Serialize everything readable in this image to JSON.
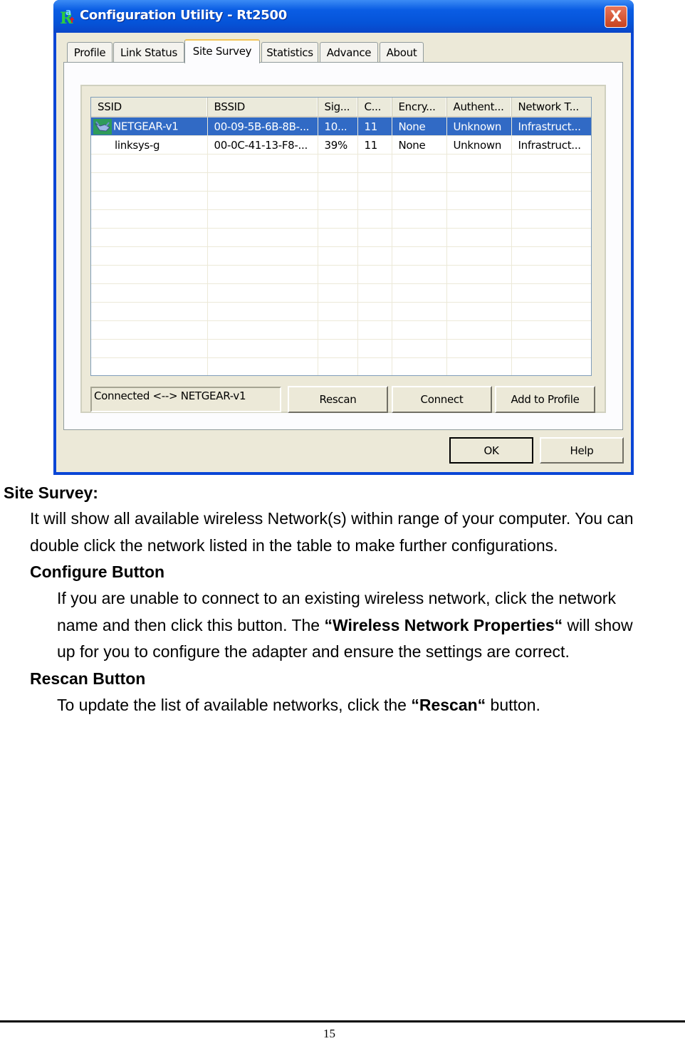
{
  "window": {
    "title": "Configuration Utility - Rt2500",
    "close_label": "X",
    "tabs": [
      {
        "label": "Profile"
      },
      {
        "label": "Link Status"
      },
      {
        "label": "Site Survey",
        "active": true
      },
      {
        "label": "Statistics"
      },
      {
        "label": "Advance"
      },
      {
        "label": "About"
      }
    ],
    "site_survey": {
      "columns": [
        "SSID",
        "BSSID",
        "Sig...",
        "C...",
        "Encry...",
        "Authent...",
        "Network T..."
      ],
      "rows": [
        {
          "ssid": "NETGEAR-v1",
          "bssid": "00-09-5B-6B-8B-...",
          "signal": "10...",
          "channel": "11",
          "encryption": "None",
          "authentication": "Unknown",
          "network_type": "Infrastruct...",
          "selected": true,
          "connected_icon": "handshake-icon"
        },
        {
          "ssid": "linksys-g",
          "bssid": "00-0C-41-13-F8-...",
          "signal": "39%",
          "channel": "11",
          "encryption": "None",
          "authentication": "Unknown",
          "network_type": "Infrastruct...",
          "selected": false
        }
      ],
      "status_text": "Connected <--> NETGEAR-v1",
      "buttons": {
        "rescan": "Rescan",
        "connect": "Connect",
        "add_to_profile": "Add to Profile"
      }
    },
    "dialog_buttons": {
      "ok": "OK",
      "help": "Help"
    },
    "colors": {
      "selection": "#316ac5",
      "titlebar": "#0553d8",
      "face": "#ece9d8"
    }
  },
  "doc": {
    "heading": "Site Survey:",
    "intro_line1": "It will show all available wireless Network(s) within range of your computer. You can",
    "intro_line2": "double click the network listed in the table to make further configurations.",
    "configure": {
      "heading": "Configure Button",
      "line1": "If you are unable to connect to an existing wireless network, click the network",
      "line2_pre": "name and then click this button. The ",
      "line2_bold": "“Wireless Network Properties“",
      "line2_post": " will show",
      "line3": "up for you to configure the adapter and ensure the settings are correct."
    },
    "rescan": {
      "heading": "Rescan Button",
      "line_pre": "To update the list of available networks, click the ",
      "line_bold": "“Rescan“",
      "line_post": " button."
    },
    "page_number": "15"
  }
}
